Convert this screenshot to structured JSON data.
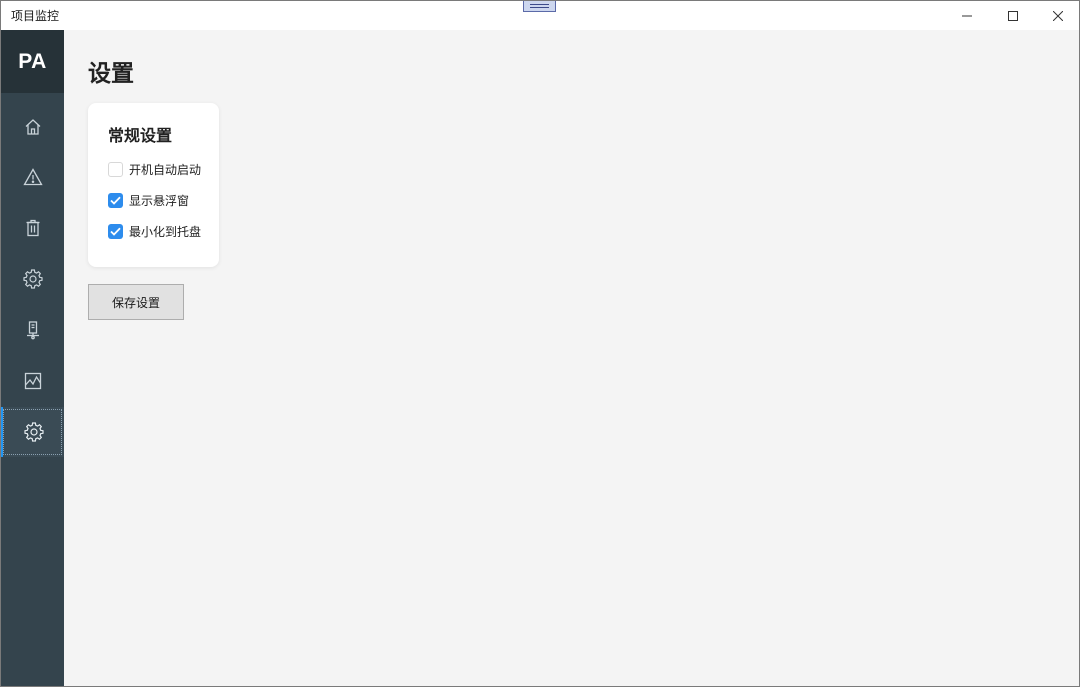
{
  "window": {
    "title": "项目监控"
  },
  "sidebar": {
    "logo": "PA",
    "items": [
      {
        "icon": "home-icon"
      },
      {
        "icon": "warning-icon"
      },
      {
        "icon": "trash-icon"
      },
      {
        "icon": "gear-icon"
      },
      {
        "icon": "device-icon"
      },
      {
        "icon": "chart-icon"
      },
      {
        "icon": "gear-icon",
        "active": true
      }
    ],
    "accent_color": "#2196f3"
  },
  "main": {
    "page_title": "设置",
    "general_card": {
      "title": "常规设置",
      "options": [
        {
          "label": "开机自动启动",
          "checked": false
        },
        {
          "label": "显示悬浮窗",
          "checked": true
        },
        {
          "label": "最小化到托盘",
          "checked": true
        }
      ]
    },
    "save_button": "保存设置"
  },
  "colors": {
    "sidebar_bg": "#34444d",
    "logo_bg": "#263238",
    "checkbox_checked": "#2d8ced",
    "content_bg": "#f4f4f4"
  }
}
